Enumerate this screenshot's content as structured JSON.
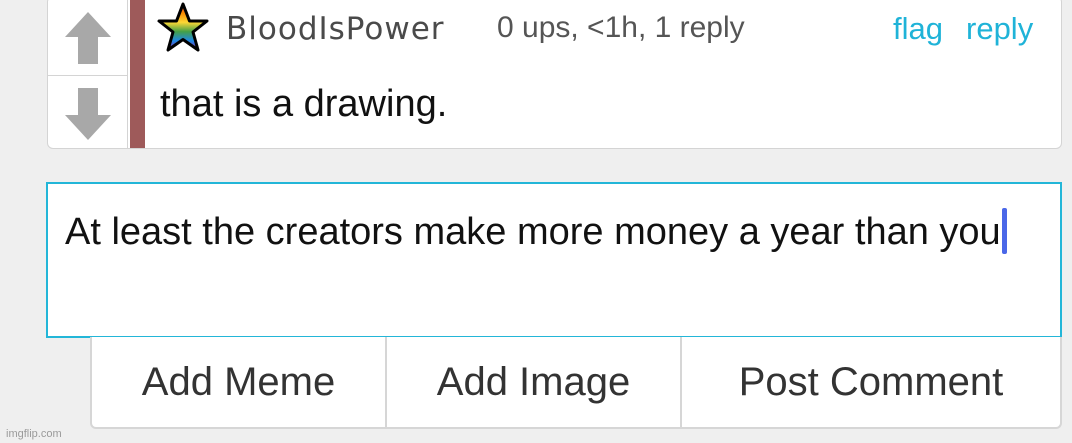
{
  "comment": {
    "username": "BloodIsPower",
    "meta": "0 ups, <1h, 1 reply",
    "flag_label": "flag",
    "reply_label": "reply",
    "text": "that is a drawing.",
    "upvote_icon": "arrow-up-icon",
    "downvote_icon": "arrow-down-icon",
    "avatar_icon": "rainbow-star-icon"
  },
  "reply_box": {
    "value": "At least the creators make more money a year than you"
  },
  "actions": {
    "add_meme": "Add Meme",
    "add_image": "Add Image",
    "post_comment": "Post Comment"
  },
  "watermark": "imgflip.com",
  "colors": {
    "accent": "#23b6d8",
    "link": "#1fb3d8",
    "thread_bar": "#9e5a5a",
    "caret": "#4a67e8"
  }
}
